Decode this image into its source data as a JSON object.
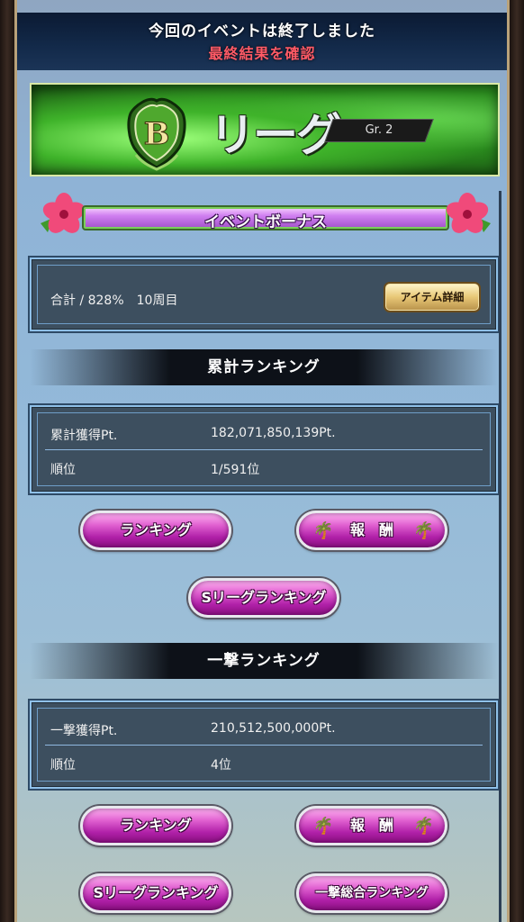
{
  "banner": {
    "line1": "今回のイベントは終了しました",
    "line2": "最終結果を確認"
  },
  "league": {
    "badge_letter": "B",
    "name": "リーグ",
    "group": "Gr. 2"
  },
  "event_bonus": {
    "title": "イベントボーナス",
    "summary": "合計 / 828%　10周目",
    "detail_button": "アイテム詳細"
  },
  "cumulative": {
    "header": "累計ランキング",
    "rows": [
      {
        "label": "累計獲得Pt.",
        "value": "182,071,850,139Pt."
      },
      {
        "label": "順位",
        "value": "1/591位"
      }
    ],
    "buttons": {
      "ranking": "ランキング",
      "reward": "報　酬",
      "s_league": "Sリーグランキング"
    }
  },
  "one_shot": {
    "header": "一撃ランキング",
    "rows": [
      {
        "label": "一撃獲得Pt.",
        "value": "210,512,500,000Pt."
      },
      {
        "label": "順位",
        "value": "4位"
      }
    ],
    "buttons": {
      "ranking": "ランキング",
      "reward": "報　酬",
      "s_league": "Sリーグランキング",
      "overall": "一撃総合ランキング"
    }
  },
  "colors": {
    "panel_blue": "#93b9d9",
    "banner_red_text": "#ff5a66",
    "button_pink": "#e060d0",
    "league_green": "#3fb32a"
  }
}
